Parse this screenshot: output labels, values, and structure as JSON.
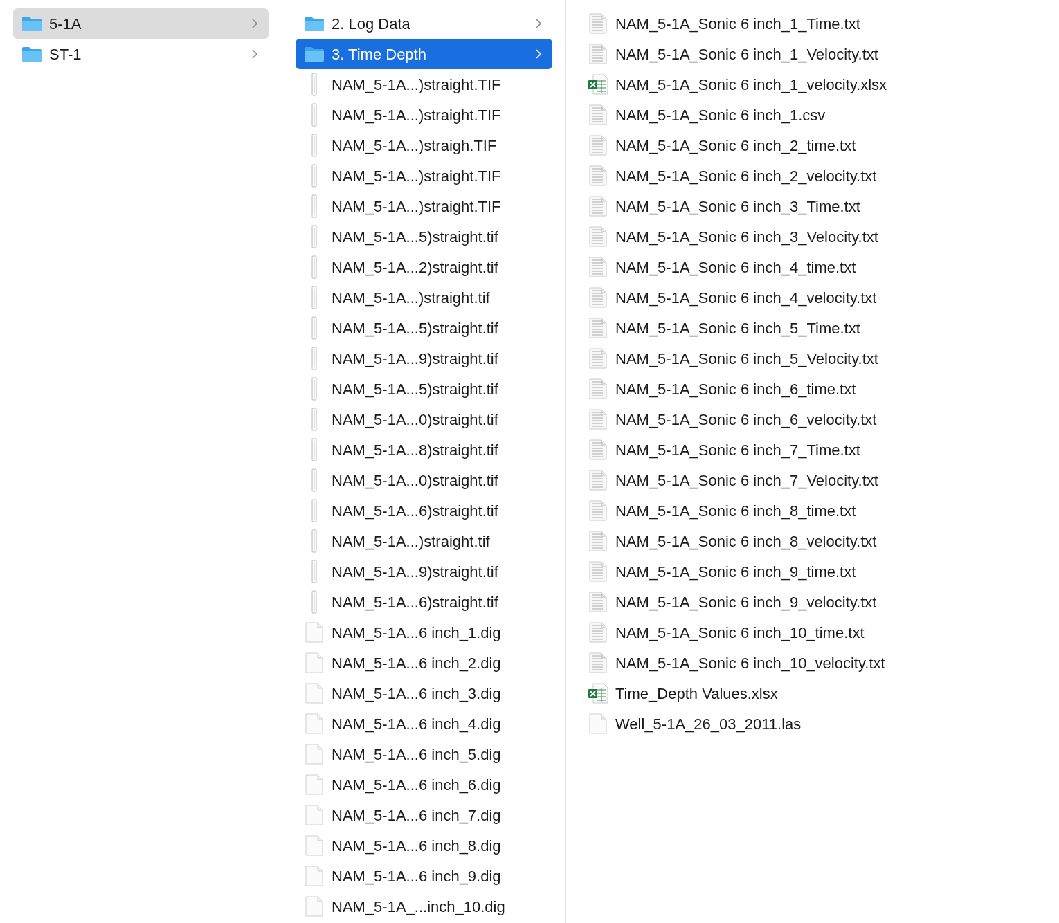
{
  "columns": [
    {
      "focused": false,
      "items": [
        {
          "name": "5-1A",
          "kind": "folder",
          "selected": true
        },
        {
          "name": "ST-1",
          "kind": "folder",
          "selected": false
        }
      ]
    },
    {
      "focused": true,
      "items": [
        {
          "name": "2. Log Data",
          "kind": "folder",
          "selected": false
        },
        {
          "name": "3. Time Depth",
          "kind": "folder",
          "selected": true
        },
        {
          "name": "NAM_5-1A...)straight.TIF",
          "kind": "tif",
          "selected": false
        },
        {
          "name": "NAM_5-1A...)straight.TIF",
          "kind": "tif",
          "selected": false
        },
        {
          "name": "NAM_5-1A...)straigh.TIF",
          "kind": "tif",
          "selected": false
        },
        {
          "name": "NAM_5-1A...)straight.TIF",
          "kind": "tif",
          "selected": false
        },
        {
          "name": "NAM_5-1A...)straight.TIF",
          "kind": "tif",
          "selected": false
        },
        {
          "name": "NAM_5-1A...5)straight.tif",
          "kind": "tif",
          "selected": false
        },
        {
          "name": "NAM_5-1A...2)straight.tif",
          "kind": "tif",
          "selected": false
        },
        {
          "name": "NAM_5-1A...)straight.tif",
          "kind": "tif",
          "selected": false
        },
        {
          "name": "NAM_5-1A...5)straight.tif",
          "kind": "tif",
          "selected": false
        },
        {
          "name": "NAM_5-1A...9)straight.tif",
          "kind": "tif",
          "selected": false
        },
        {
          "name": "NAM_5-1A...5)straight.tif",
          "kind": "tif",
          "selected": false
        },
        {
          "name": "NAM_5-1A...0)straight.tif",
          "kind": "tif",
          "selected": false
        },
        {
          "name": "NAM_5-1A...8)straight.tif",
          "kind": "tif",
          "selected": false
        },
        {
          "name": "NAM_5-1A...0)straight.tif",
          "kind": "tif",
          "selected": false
        },
        {
          "name": "NAM_5-1A...6)straight.tif",
          "kind": "tif",
          "selected": false
        },
        {
          "name": "NAM_5-1A...)straight.tif",
          "kind": "tif",
          "selected": false
        },
        {
          "name": "NAM_5-1A...9)straight.tif",
          "kind": "tif",
          "selected": false
        },
        {
          "name": "NAM_5-1A...6)straight.tif",
          "kind": "tif",
          "selected": false
        },
        {
          "name": "NAM_5-1A...6 inch_1.dig",
          "kind": "blank",
          "selected": false
        },
        {
          "name": "NAM_5-1A...6 inch_2.dig",
          "kind": "blank",
          "selected": false
        },
        {
          "name": "NAM_5-1A...6 inch_3.dig",
          "kind": "blank",
          "selected": false
        },
        {
          "name": "NAM_5-1A...6 inch_4.dig",
          "kind": "blank",
          "selected": false
        },
        {
          "name": "NAM_5-1A...6 inch_5.dig",
          "kind": "blank",
          "selected": false
        },
        {
          "name": "NAM_5-1A...6 inch_6.dig",
          "kind": "blank",
          "selected": false
        },
        {
          "name": "NAM_5-1A...6 inch_7.dig",
          "kind": "blank",
          "selected": false
        },
        {
          "name": "NAM_5-1A...6 inch_8.dig",
          "kind": "blank",
          "selected": false
        },
        {
          "name": "NAM_5-1A...6 inch_9.dig",
          "kind": "blank",
          "selected": false
        },
        {
          "name": "NAM_5-1A_...inch_10.dig",
          "kind": "blank",
          "selected": false
        }
      ]
    },
    {
      "items": [
        {
          "name": "NAM_5-1A_Sonic 6 inch_1_Time.txt",
          "kind": "text",
          "selected": false
        },
        {
          "name": "NAM_5-1A_Sonic 6 inch_1_Velocity.txt",
          "kind": "text",
          "selected": false
        },
        {
          "name": "NAM_5-1A_Sonic 6 inch_1_velocity.xlsx",
          "kind": "excel",
          "selected": false
        },
        {
          "name": "NAM_5-1A_Sonic 6 inch_1.csv",
          "kind": "text",
          "selected": false
        },
        {
          "name": "NAM_5-1A_Sonic 6 inch_2_time.txt",
          "kind": "text",
          "selected": false
        },
        {
          "name": "NAM_5-1A_Sonic 6 inch_2_velocity.txt",
          "kind": "text",
          "selected": false
        },
        {
          "name": "NAM_5-1A_Sonic 6 inch_3_Time.txt",
          "kind": "text",
          "selected": false
        },
        {
          "name": "NAM_5-1A_Sonic 6 inch_3_Velocity.txt",
          "kind": "text",
          "selected": false
        },
        {
          "name": "NAM_5-1A_Sonic 6 inch_4_time.txt",
          "kind": "text",
          "selected": false
        },
        {
          "name": "NAM_5-1A_Sonic 6 inch_4_velocity.txt",
          "kind": "text",
          "selected": false
        },
        {
          "name": "NAM_5-1A_Sonic 6 inch_5_Time.txt",
          "kind": "text",
          "selected": false
        },
        {
          "name": "NAM_5-1A_Sonic 6 inch_5_Velocity.txt",
          "kind": "text",
          "selected": false
        },
        {
          "name": "NAM_5-1A_Sonic 6 inch_6_time.txt",
          "kind": "text",
          "selected": false
        },
        {
          "name": "NAM_5-1A_Sonic 6 inch_6_velocity.txt",
          "kind": "text",
          "selected": false
        },
        {
          "name": "NAM_5-1A_Sonic 6 inch_7_Time.txt",
          "kind": "text",
          "selected": false
        },
        {
          "name": "NAM_5-1A_Sonic 6 inch_7_Velocity.txt",
          "kind": "text",
          "selected": false
        },
        {
          "name": "NAM_5-1A_Sonic 6 inch_8_time.txt",
          "kind": "text",
          "selected": false
        },
        {
          "name": "NAM_5-1A_Sonic 6 inch_8_velocity.txt",
          "kind": "text",
          "selected": false
        },
        {
          "name": "NAM_5-1A_Sonic 6 inch_9_time.txt",
          "kind": "text",
          "selected": false
        },
        {
          "name": "NAM_5-1A_Sonic 6 inch_9_velocity.txt",
          "kind": "text",
          "selected": false
        },
        {
          "name": "NAM_5-1A_Sonic 6 inch_10_time.txt",
          "kind": "text",
          "selected": false
        },
        {
          "name": "NAM_5-1A_Sonic 6 inch_10_velocity.txt",
          "kind": "text",
          "selected": false
        },
        {
          "name": "Time_Depth Values.xlsx",
          "kind": "excel",
          "selected": false
        },
        {
          "name": "Well_5-1A_26_03_2011.las",
          "kind": "blank",
          "selected": false
        }
      ]
    }
  ]
}
